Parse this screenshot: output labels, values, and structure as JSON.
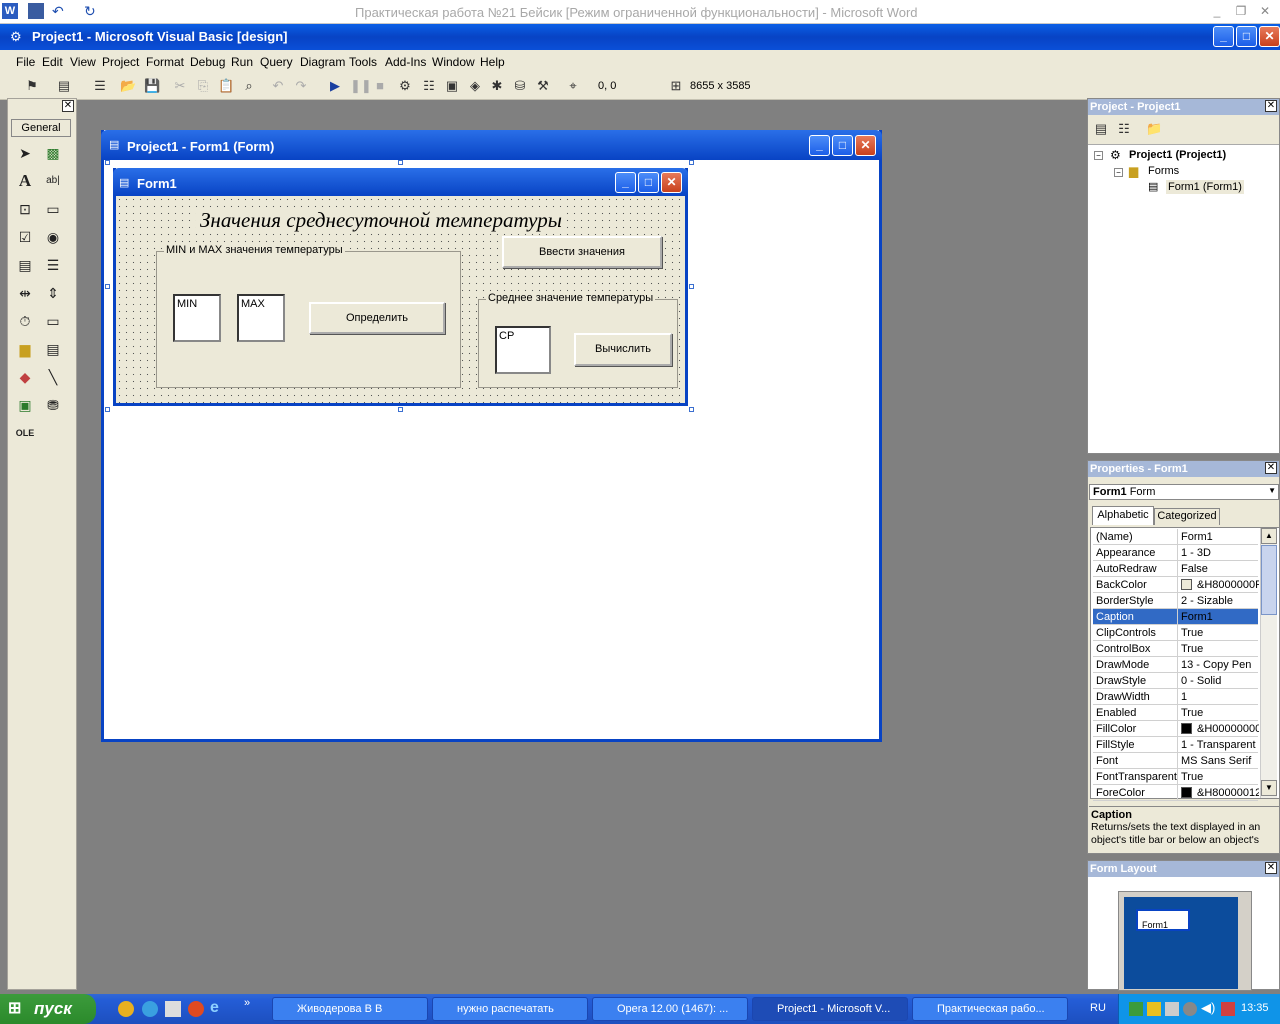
{
  "word": {
    "title": "Практическая работа №21 Бейсик [Режим ограниченной функциональности]  -  Microsoft Word"
  },
  "vb": {
    "title": "Project1 - Microsoft Visual Basic [design]"
  },
  "menu": [
    "File",
    "Edit",
    "View",
    "Project",
    "Format",
    "Debug",
    "Run",
    "Query",
    "Diagram",
    "Tools",
    "Add-Ins",
    "Window",
    "Help"
  ],
  "toolbar": {
    "position": "0, 0",
    "size": "8655 x 3585"
  },
  "toolbox": {
    "header": "General"
  },
  "designer": {
    "title": "Project1 - Form1 (Form)"
  },
  "form": {
    "title": "Form1",
    "heading": "Значения среднесуточной температуры",
    "frame_minmax": "MIN и MAX значения температуры",
    "frame_avg": "Среднее значение температуры",
    "min_box": "MIN",
    "max_box": "MAX",
    "btn_determine": "Определить",
    "btn_enter": "Ввести значения",
    "avg_box": "СР",
    "btn_calc": "Вычислить"
  },
  "project": {
    "header": "Project - Project1",
    "root": "Project1 (Project1)",
    "folder": "Forms",
    "item": "Form1 (Form1)"
  },
  "properties": {
    "header": "Properties - Form1",
    "object": "Form1",
    "object_type": "Form",
    "tab_alpha": "Alphabetic",
    "tab_cat": "Categorized",
    "rows": [
      [
        "(Name)",
        "Form1"
      ],
      [
        "Appearance",
        "1 - 3D"
      ],
      [
        "AutoRedraw",
        "False"
      ],
      [
        "BackColor",
        "&H8000000F"
      ],
      [
        "BorderStyle",
        "2 - Sizable"
      ],
      [
        "Caption",
        "Form1"
      ],
      [
        "ClipControls",
        "True"
      ],
      [
        "ControlBox",
        "True"
      ],
      [
        "DrawMode",
        "13 - Copy Pen"
      ],
      [
        "DrawStyle",
        "0 - Solid"
      ],
      [
        "DrawWidth",
        "1"
      ],
      [
        "Enabled",
        "True"
      ],
      [
        "FillColor",
        "&H00000000"
      ],
      [
        "FillStyle",
        "1 - Transparent"
      ],
      [
        "Font",
        "MS Sans Serif"
      ],
      [
        "FontTransparent",
        "True"
      ],
      [
        "ForeColor",
        "&H80000012"
      ]
    ],
    "desc_title": "Caption",
    "desc_text": "Returns/sets the text displayed in an object's title bar or below an object's"
  },
  "layout": {
    "header": "Form Layout",
    "preview": "Form1"
  },
  "taskbar": {
    "start": "пуск",
    "tasks": [
      "Живодерова В В",
      "нужно распечатать",
      "Opera 12.00 (1467): ...",
      "Project1 - Microsoft V...",
      "Практическая рабо..."
    ],
    "lang": "RU",
    "clock": "13:35"
  }
}
